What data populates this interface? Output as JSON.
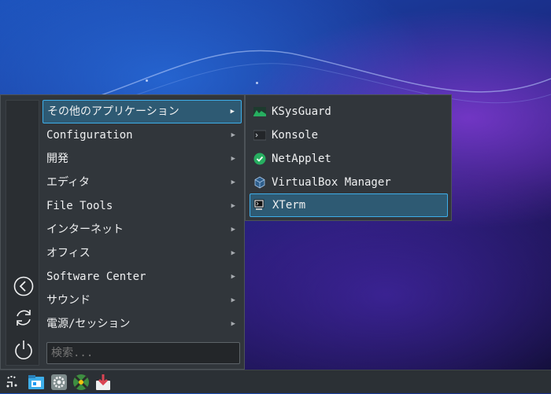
{
  "menu": {
    "categories": [
      {
        "label": "その他のアプリケーション"
      },
      {
        "label": "Configuration"
      },
      {
        "label": "開発"
      },
      {
        "label": "エディタ"
      },
      {
        "label": "File Tools"
      },
      {
        "label": "インターネット"
      },
      {
        "label": "オフィス"
      },
      {
        "label": "Software Center"
      },
      {
        "label": "サウンド"
      },
      {
        "label": "電源/セッション"
      }
    ],
    "active_category_index": 0,
    "arrow_glyph": "▶",
    "side_buttons": [
      {
        "icon": "back-icon"
      },
      {
        "icon": "refresh-icon"
      },
      {
        "icon": "power-icon"
      }
    ],
    "search": {
      "placeholder": "検索..."
    }
  },
  "submenu": {
    "items": [
      {
        "label": "KSysGuard",
        "icon": "ksysguard-icon"
      },
      {
        "label": "Konsole",
        "icon": "konsole-icon"
      },
      {
        "label": "NetApplet",
        "icon": "netapplet-icon"
      },
      {
        "label": "VirtualBox Manager",
        "icon": "virtualbox-icon"
      },
      {
        "label": "XTerm",
        "icon": "xterm-icon"
      }
    ],
    "active_item_index": 4
  },
  "taskbar": {
    "icons": [
      "app-launcher-icon",
      "file-manager-icon",
      "settings-icon",
      "package-manager-icon",
      "software-update-icon"
    ]
  },
  "colors": {
    "highlight_border": "#3daee9",
    "highlight_fill": "#2e5a73",
    "menu_bg": "#31363b",
    "text": "#eff0f1"
  }
}
